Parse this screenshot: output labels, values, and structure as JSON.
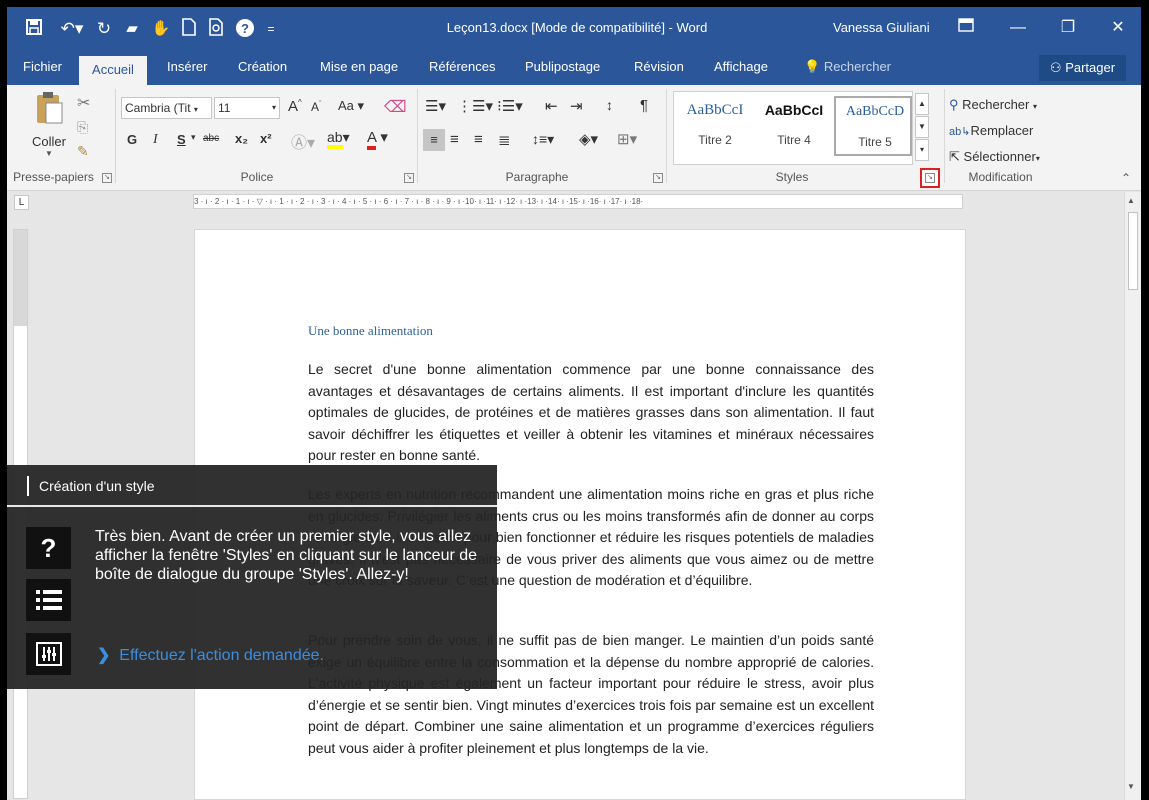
{
  "titlebar": {
    "title": "Leçon13.docx [Mode de compatibilité] - Word",
    "user": "Vanessa Giuliani"
  },
  "tabs": [
    "Fichier",
    "Accueil",
    "Insérer",
    "Création",
    "Mise en page",
    "Références",
    "Publipostage",
    "Révision",
    "Affichage"
  ],
  "tell_me": "Rechercher",
  "share": "Partager",
  "clipboard": {
    "paste": "Coller",
    "label": "Presse-papiers"
  },
  "font": {
    "name": "Cambria (Tit",
    "size": "11",
    "case": "Aa",
    "bold": "G",
    "italic": "I",
    "underline": "S",
    "strike": "abc",
    "sub": "x₂",
    "sup": "x²",
    "label": "Police"
  },
  "paragraph": {
    "label": "Paragraphe"
  },
  "styles": {
    "label": "Styles",
    "items": [
      {
        "preview": "AaBbCcI",
        "name": "Titre 2"
      },
      {
        "preview": "AaBbCcI",
        "name": "Titre 4"
      },
      {
        "preview": "AaBbCcD",
        "name": "Titre 5"
      }
    ]
  },
  "editing": {
    "find": "Rechercher",
    "replace": "Remplacer",
    "select": "Sélectionner",
    "label": "Modification"
  },
  "ruler": "3 · ı · 2 · ı · 1 · ı · ▽ · ı · 1 · ı · 2 · ı · 3 · ı · 4 · ı · 5 · ı · 6 · ı · 7 · ı · 8 · ı · 9 · ı ·10· ı ·11· ı ·12· ı ·13· ı ·14· ı ·15· ı ·16· ı ·17· ı ·18·",
  "document": {
    "heading": "Une bonne alimentation",
    "p1": "Le secret d'une bonne alimentation commence par une bonne connaissance des avantages et désavantages de certains aliments. Il est important d'inclure les quantités optimales de glucides, de protéines et de matières grasses dans son alimentation. Il faut savoir déchiffrer les étiquettes et veiller à obtenir les vitamines et minéraux nécessaires pour rester en bonne santé.",
    "p2": "Les experts en nutrition recommandent une alimentation moins riche en gras et plus riche en glucides. Privilégier les aliments crus ou les moins transformés afin de donner au corps l’énergie dont il a besoin pour bien fonctionner et réduire les risques potentiels de maladies graves. Il n'est pas nécessaire de vous priver des aliments que vous aimez ou de mettre une croix sur la saveur. C’est une question de modération et d’équilibre.",
    "p3": "Pour prendre soin de vous, il ne suffit pas de bien manger. Le maintien d’un poids santé exige un équilibre entre la consommation et la dépense du nombre approprié de calories. L'activité physique est également un facteur important pour réduire le stress, avoir plus d’énergie et se sentir bien. Vingt minutes d’exercices trois fois par semaine est un excellent point de départ. Combiner une saine alimentation et un programme d’exercices réguliers peut vous aider à profiter pleinement et plus longtemps de la vie."
  },
  "coach": {
    "title": "Création d'un style",
    "message": "Très bien. Avant de créer un premier style, vous allez afficher la fenêtre 'Styles' en cliquant sur le lanceur de boîte de dialogue du groupe 'Styles'. Allez-y!",
    "action": "Effectuez l'action demandée."
  },
  "colors": {
    "accent": "#2b579a",
    "highlight": "#e02020",
    "coach_link": "#3b8ee0"
  }
}
